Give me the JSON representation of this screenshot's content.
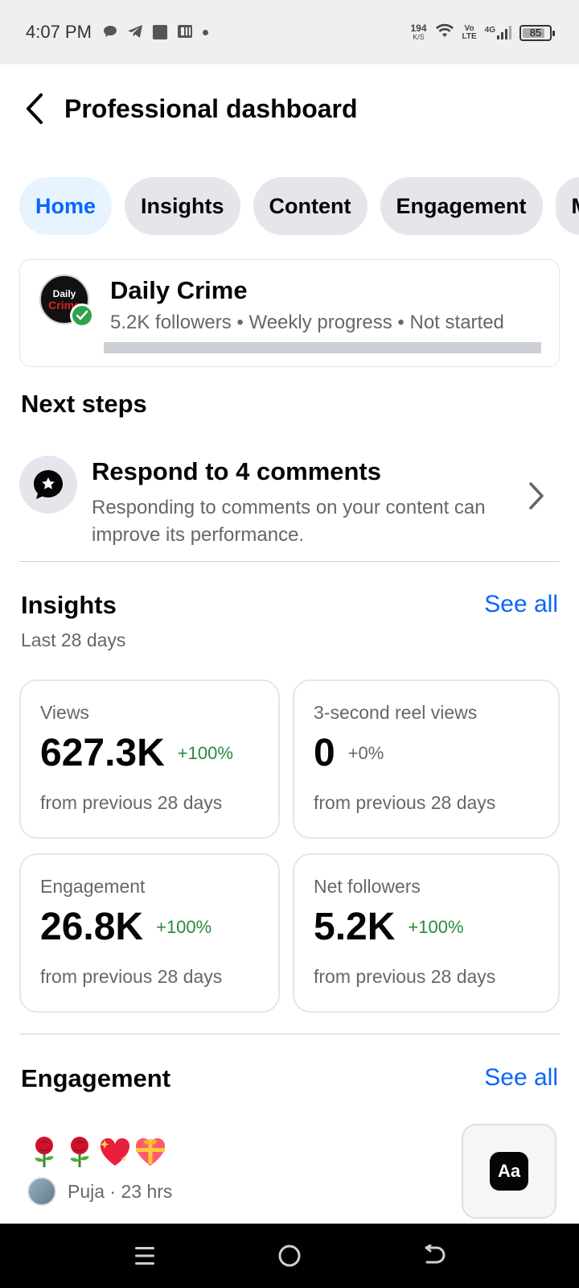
{
  "status_bar": {
    "time": "4:07 PM",
    "net_speed_value": "194",
    "net_speed_unit": "K/S",
    "volte_top": "Vo",
    "volte_bottom": "LTE",
    "network": "4G",
    "battery": "85",
    "battery_level": 0.85
  },
  "header": {
    "title": "Professional dashboard"
  },
  "tabs": [
    {
      "label": "Home",
      "active": true
    },
    {
      "label": "Insights",
      "active": false
    },
    {
      "label": "Content",
      "active": false
    },
    {
      "label": "Engagement",
      "active": false
    },
    {
      "label": "M",
      "active": false
    }
  ],
  "profile": {
    "name": "Daily Crime",
    "avatar_text_1": "Daily",
    "avatar_text_2": "Crime",
    "meta": "5.2K followers • Weekly progress • Not started",
    "weekly_progress": 0
  },
  "next_steps": {
    "title": "Next steps",
    "item": {
      "title": "Respond to 4 comments",
      "description": "Responding to comments on your content can improve its performance."
    }
  },
  "insights": {
    "title": "Insights",
    "see_all": "See all",
    "period": "Last 28 days",
    "metrics": [
      {
        "label": "Views",
        "value": "627.3K",
        "change": "+100%",
        "foot": "from previous 28 days"
      },
      {
        "label": "3-second reel views",
        "value": "0",
        "change": "+0%",
        "foot": "from previous 28 days"
      },
      {
        "label": "Engagement",
        "value": "26.8K",
        "change": "+100%",
        "foot": "from previous 28 days"
      },
      {
        "label": "Net followers",
        "value": "5.2K",
        "change": "+100%",
        "foot": "from previous 28 days"
      }
    ]
  },
  "engagement": {
    "title": "Engagement",
    "see_all": "See all",
    "comment_reactions": [
      "rose-icon",
      "rose-icon",
      "sparkling-heart-icon",
      "gift-heart-icon"
    ],
    "commenter": "Puja · 23 hrs",
    "text_button": "Aa"
  },
  "colors": {
    "accent": "#0866ff",
    "positive": "#2a8a3a",
    "secondary_text": "#65676b"
  }
}
